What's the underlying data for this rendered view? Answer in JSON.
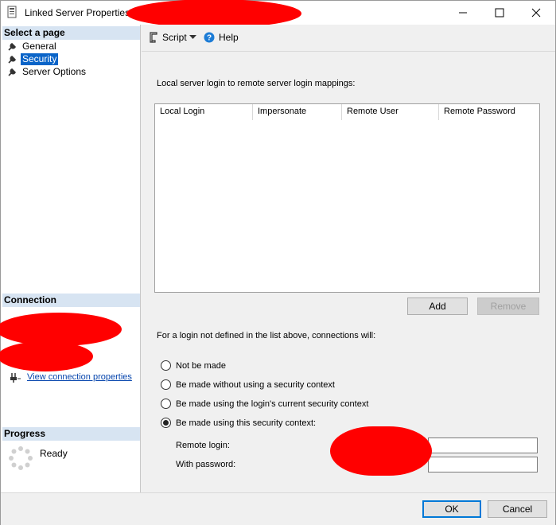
{
  "window": {
    "title": "Linked Server Properties",
    "icons": {
      "app": "server-icon",
      "minimize": "minimize-icon",
      "maximize": "maximize-icon",
      "close": "close-icon"
    }
  },
  "left_pane": {
    "select_page_header": "Select a page",
    "pages": [
      {
        "label": "General",
        "icon": "wrench-icon",
        "selected": false
      },
      {
        "label": "Security",
        "icon": "wrench-icon",
        "selected": true
      },
      {
        "label": "Server Options",
        "icon": "wrench-icon",
        "selected": false
      }
    ],
    "connection_header": "Connection",
    "view_connection_link": "View connection properties",
    "progress_header": "Progress",
    "progress_status": "Ready"
  },
  "toolbar": {
    "script_label": "Script",
    "help_label": "Help",
    "icons": {
      "script": "script-icon",
      "dropdown": "chevron-down-icon",
      "help": "help-icon"
    }
  },
  "security": {
    "mappings_label": "Local server login to remote server login mappings:",
    "columns": [
      "Local Login",
      "Impersonate",
      "Remote User",
      "Remote Password"
    ],
    "rows": [],
    "add_button": "Add",
    "remove_button": "Remove",
    "connection_prompt": "For a login not defined in the list above, connections will:",
    "options": [
      {
        "label": "Not be made",
        "checked": false
      },
      {
        "label": "Be made without using a security context",
        "checked": false
      },
      {
        "label": "Be made using the login's current security context",
        "checked": false
      },
      {
        "label": "Be made using this security context:",
        "checked": true
      }
    ],
    "remote_login_label": "Remote login:",
    "remote_login_value": "",
    "password_label": "With password:",
    "password_value": ""
  },
  "footer": {
    "ok_button": "OK",
    "cancel_button": "Cancel"
  },
  "colors": {
    "selection": "#0a64c8",
    "section_header": "#d7e4f2",
    "redaction": "#ff0000",
    "link": "#0645ad",
    "default_button_border": "#0078d7"
  }
}
